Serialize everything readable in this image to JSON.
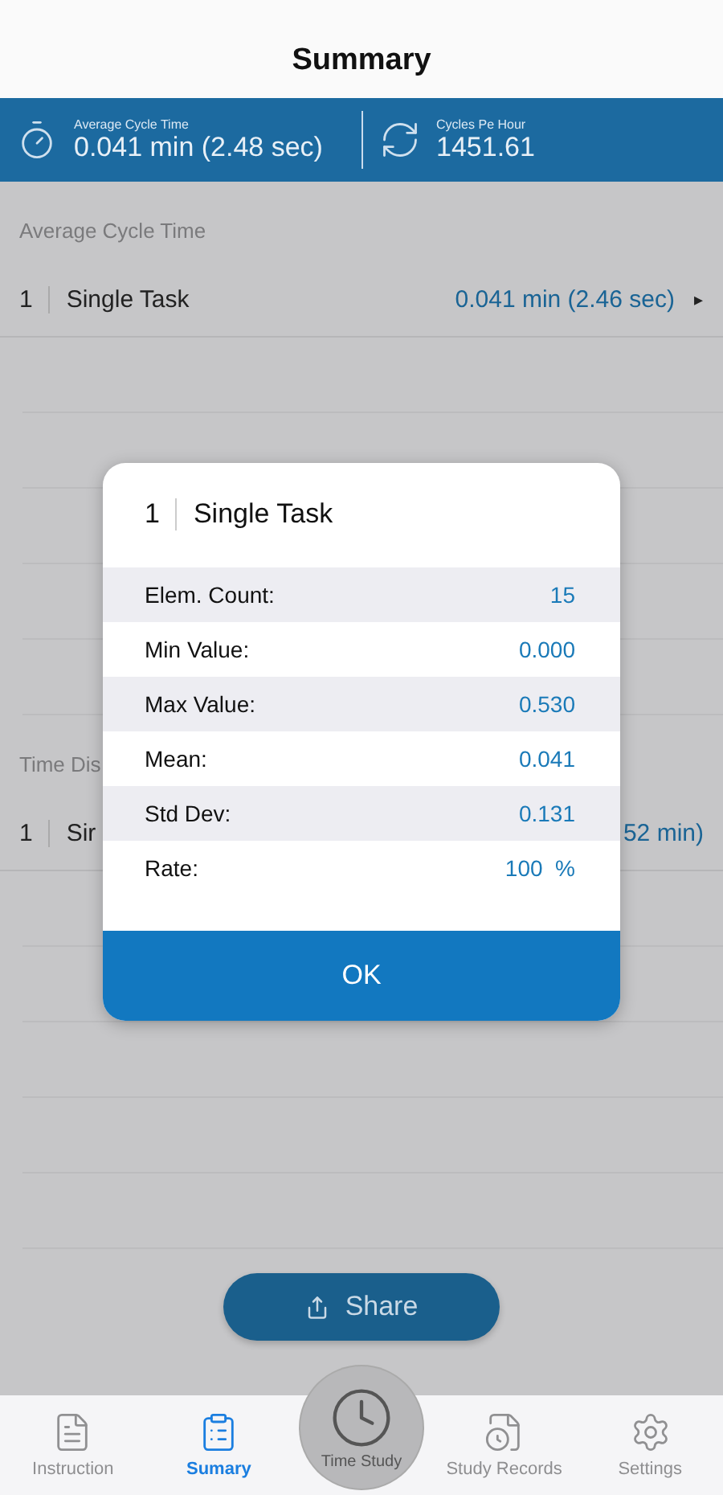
{
  "header": {
    "title": "Summary"
  },
  "stats": [
    {
      "kind": "timer",
      "label": "Average Cycle Time",
      "value": "0.041 min (2.48 sec)"
    },
    {
      "kind": "cycle",
      "label": "Cycles Pe Hour",
      "value": "1451.61"
    }
  ],
  "sections": [
    {
      "label": "Average Cycle Time",
      "rows": [
        {
          "index": "1",
          "name": "Single Task",
          "value": "0.041 min (2.46 sec)",
          "arrow": "▸"
        }
      ]
    },
    {
      "label": "Time Dis",
      "rows": [
        {
          "index": "1",
          "name": "Sir",
          "value": "52 min)"
        }
      ]
    }
  ],
  "dialog": {
    "index": "1",
    "title": "Single Task",
    "rows": [
      {
        "label": "Elem. Count:",
        "value": "15"
      },
      {
        "label": "Min Value:",
        "value": "0.000"
      },
      {
        "label": "Max Value:",
        "value": "0.530"
      },
      {
        "label": "Mean:",
        "value": "0.041"
      },
      {
        "label": "Std Dev:",
        "value": "0.131"
      },
      {
        "label": "Rate:",
        "value": "100  %"
      }
    ],
    "button": "OK"
  },
  "share_button": "Share",
  "tabs": [
    {
      "kind": "instruction",
      "label": "Instruction",
      "selected": false
    },
    {
      "kind": "summary",
      "label": "Sumary",
      "selected": true
    },
    {
      "kind": "timestudy",
      "label": "Time Study",
      "selected": false
    },
    {
      "kind": "records",
      "label": "Study Records",
      "selected": false
    },
    {
      "kind": "settings",
      "label": "Settings",
      "selected": false
    }
  ]
}
